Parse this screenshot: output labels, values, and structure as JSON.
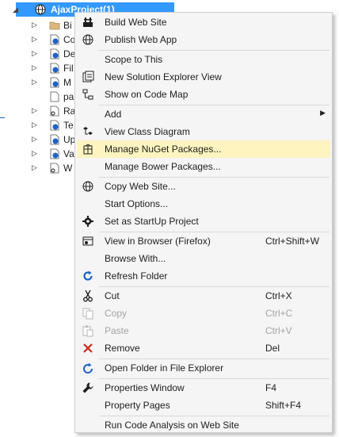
{
  "tree": {
    "root_label": "AjaxProject(1)",
    "rows": [
      {
        "label": "Bi",
        "icon": "folder-icon"
      },
      {
        "label": "Co",
        "icon": "web-file-icon"
      },
      {
        "label": "De",
        "icon": "web-file-icon"
      },
      {
        "label": "Fil",
        "icon": "web-file-icon"
      },
      {
        "label": "M",
        "icon": "web-file-icon"
      },
      {
        "label": "pa",
        "icon": "file-icon"
      },
      {
        "label": "Ra",
        "icon": "file-key-icon"
      },
      {
        "label": "Te",
        "icon": "web-file-icon"
      },
      {
        "label": "Up",
        "icon": "web-file-icon"
      },
      {
        "label": "Va",
        "icon": "web-file-icon"
      },
      {
        "label": "W",
        "icon": "web-config-icon"
      }
    ]
  },
  "menu": {
    "items": [
      {
        "label": "Build Web Site",
        "shortcut": "",
        "icon": "build-icon"
      },
      {
        "label": "Publish Web App",
        "shortcut": "",
        "icon": "publish-globe-icon"
      },
      {
        "label": "Scope to This",
        "shortcut": "",
        "icon": ""
      },
      {
        "label": "New Solution Explorer View",
        "shortcut": "",
        "icon": "new-view-icon"
      },
      {
        "label": "Show on Code Map",
        "shortcut": "",
        "icon": "code-map-icon"
      },
      {
        "label": "Add",
        "shortcut": "",
        "icon": ""
      },
      {
        "label": "View Class Diagram",
        "shortcut": "",
        "icon": "class-diagram-icon"
      },
      {
        "label": "Manage NuGet Packages...",
        "shortcut": "",
        "icon": "nuget-icon"
      },
      {
        "label": "Manage Bower Packages...",
        "shortcut": "",
        "icon": ""
      },
      {
        "label": "Copy Web Site...",
        "shortcut": "",
        "icon": "copy-web-icon"
      },
      {
        "label": "Start Options...",
        "shortcut": "",
        "icon": ""
      },
      {
        "label": "Set as StartUp Project",
        "shortcut": "",
        "icon": "gear-icon"
      },
      {
        "label": "View in Browser (Firefox)",
        "shortcut": "Ctrl+Shift+W",
        "icon": "browser-icon"
      },
      {
        "label": "Browse With...",
        "shortcut": "",
        "icon": ""
      },
      {
        "label": "Refresh Folder",
        "shortcut": "",
        "icon": "refresh-icon"
      },
      {
        "label": "Cut",
        "shortcut": "Ctrl+X",
        "icon": "cut-icon"
      },
      {
        "label": "Copy",
        "shortcut": "Ctrl+C",
        "icon": "copy-icon"
      },
      {
        "label": "Paste",
        "shortcut": "Ctrl+V",
        "icon": "paste-icon"
      },
      {
        "label": "Remove",
        "shortcut": "Del",
        "icon": "remove-icon"
      },
      {
        "label": "Open Folder in File Explorer",
        "shortcut": "",
        "icon": "open-folder-icon"
      },
      {
        "label": "Properties Window",
        "shortcut": "F4",
        "icon": "wrench-icon"
      },
      {
        "label": "Property Pages",
        "shortcut": "Shift+F4",
        "icon": ""
      },
      {
        "label": "Run Code Analysis on Web Site",
        "shortcut": "",
        "icon": ""
      }
    ]
  },
  "colors": {
    "highlight": "#fdf4bf",
    "selection": "#3399ff",
    "disabled_text": "#a2a4a5",
    "remove_red": "#c42b1c",
    "refresh_blue": "#1e64c8"
  }
}
